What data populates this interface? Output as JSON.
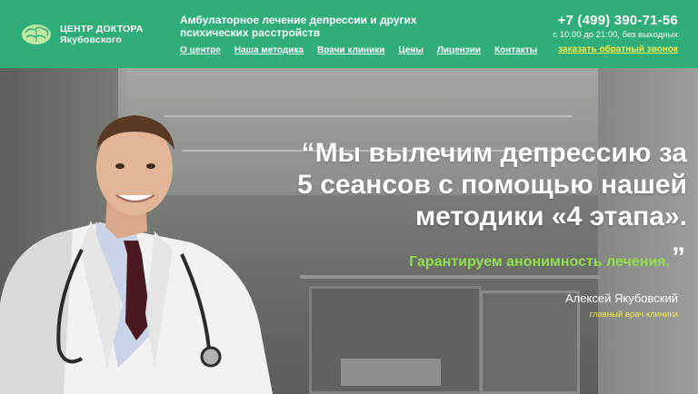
{
  "header": {
    "logo_line1": "ЦЕНТР ДОКТОРА",
    "logo_line2": "Якубовского",
    "tagline": "Амбулаторное лечение депрессии и других психических расстройств",
    "nav": [
      {
        "label": "О центре"
      },
      {
        "label": "Наша методика"
      },
      {
        "label": "Врачи клиники"
      },
      {
        "label": "Цены"
      },
      {
        "label": "Лицензии"
      },
      {
        "label": "Контакты"
      }
    ],
    "phone": "+7 (499) 390-71-56",
    "hours": "с 10:00 до 21:00, без выходных",
    "callback": "заказать обратный звонок"
  },
  "hero": {
    "quote_line1": "“Мы вылечим депрессию за",
    "quote_line2": "5 сеансов с помощью нашей",
    "quote_line3": "методики «4 этапа».",
    "guarantee": "Гарантируем анонимность  лечения.",
    "close_quote": "”",
    "author_name": "Алексей Якубовский",
    "author_role": "главный врач клиники"
  },
  "colors": {
    "header_bg": "#2fae79",
    "callback": "#f6e94a",
    "guarantee": "#8fe04c"
  },
  "icons": {
    "logo": "brain-icon"
  }
}
